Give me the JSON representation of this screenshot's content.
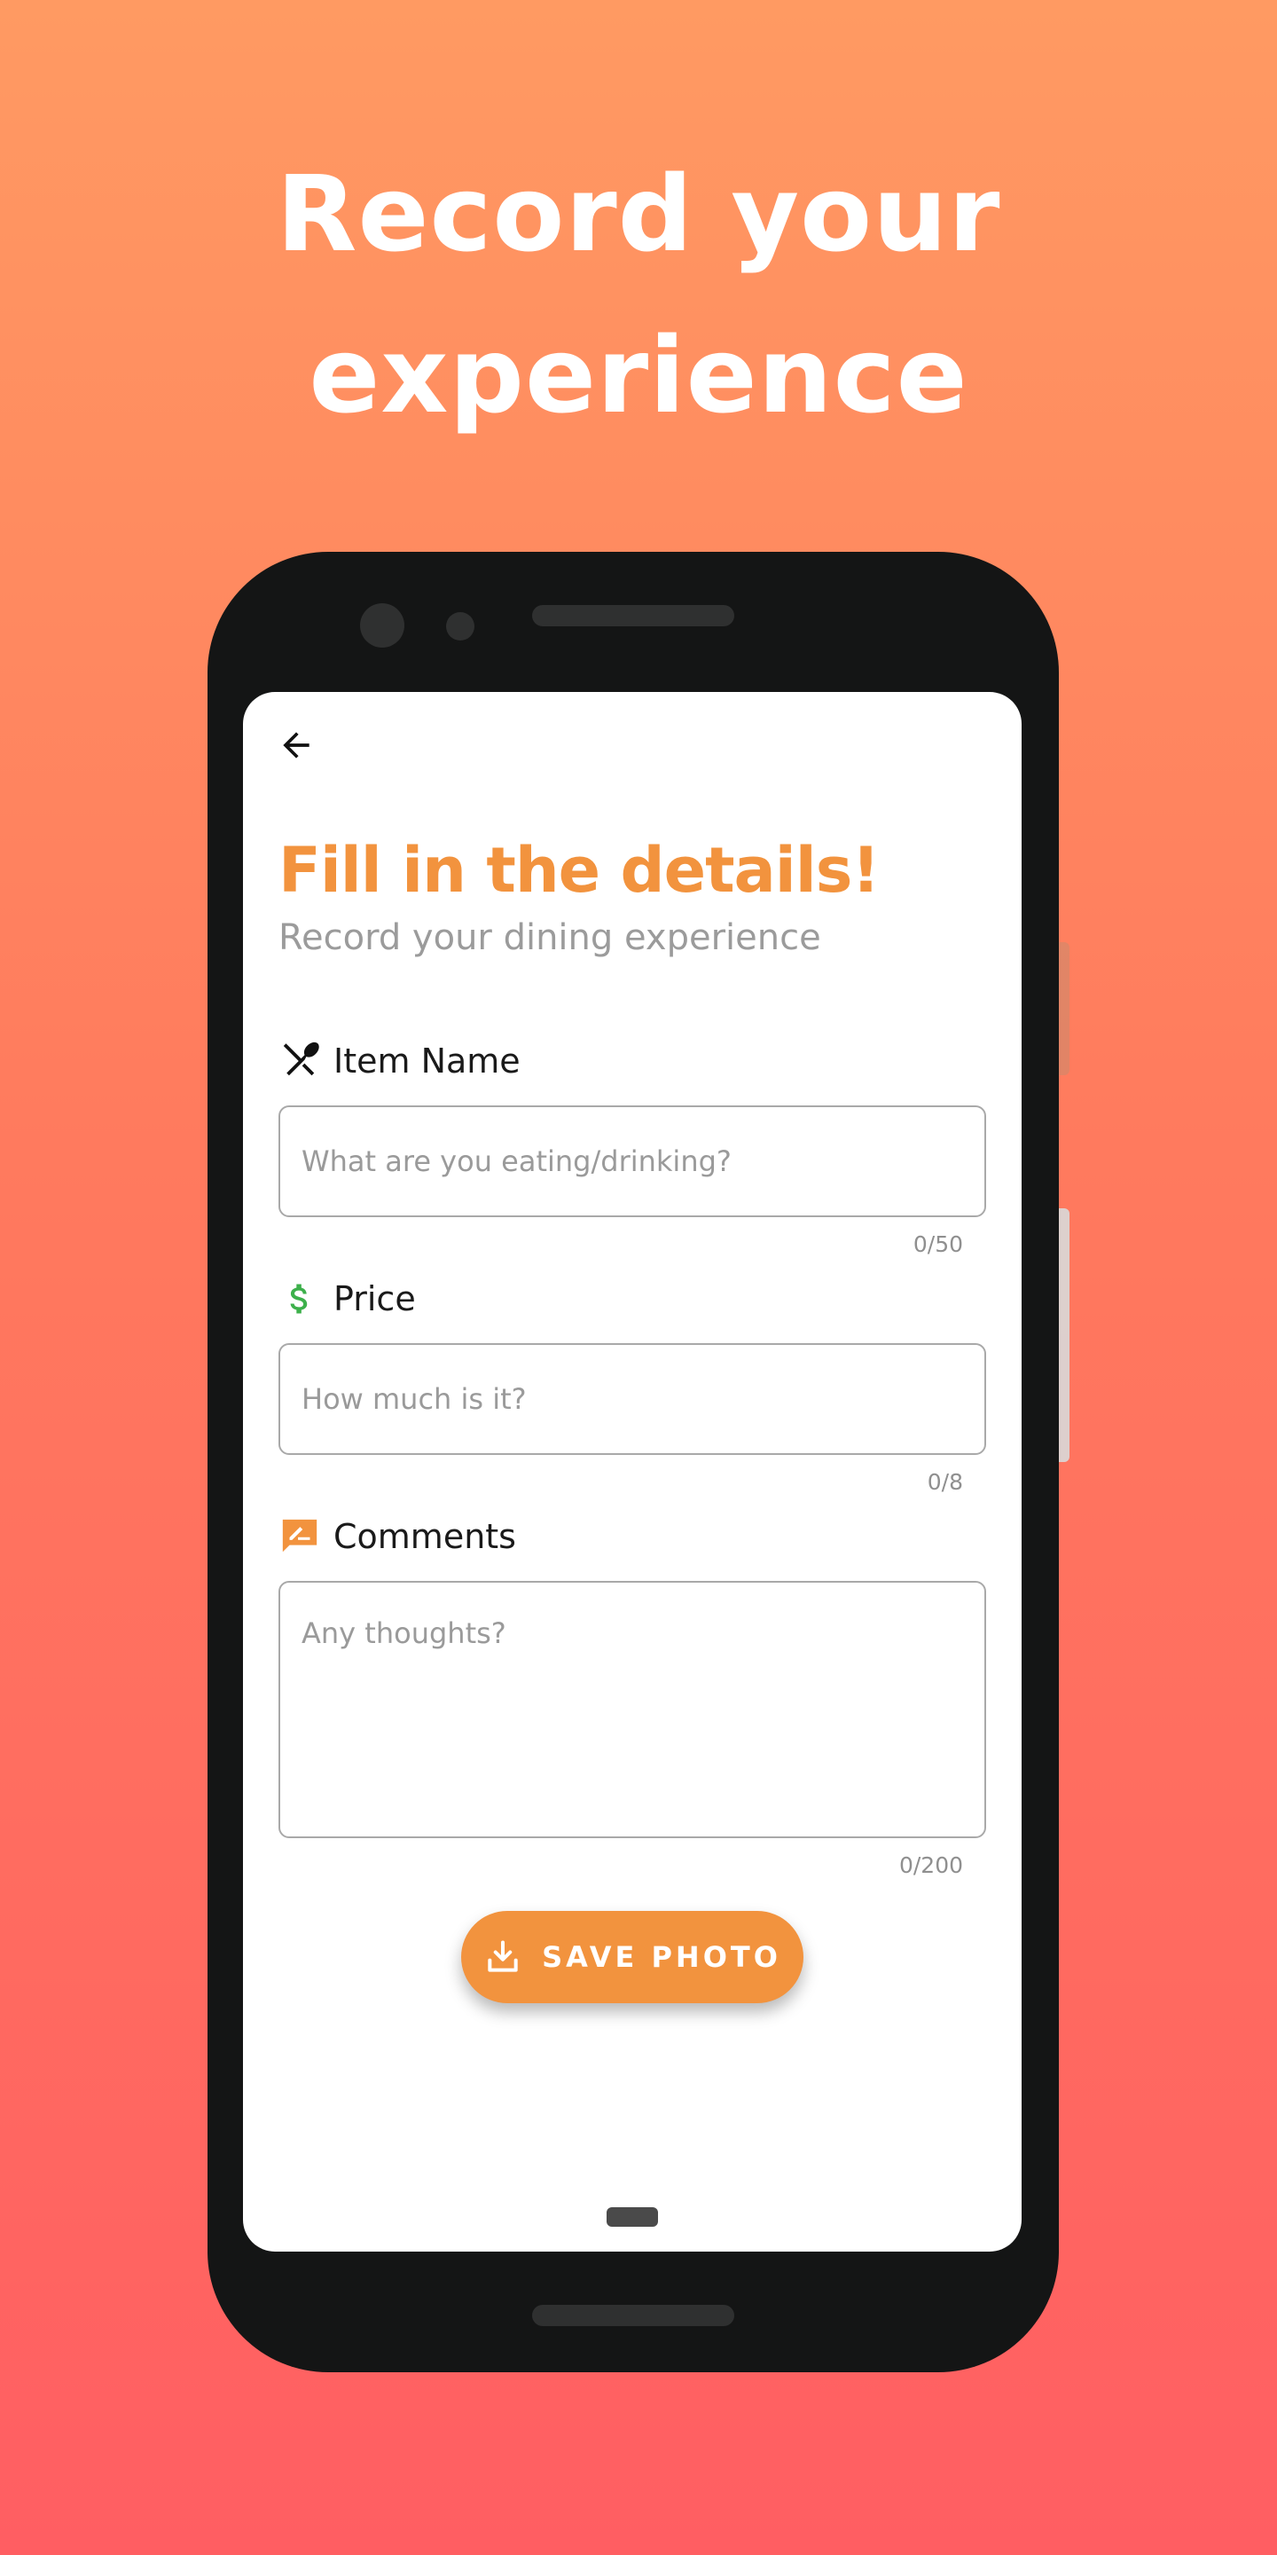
{
  "headline": {
    "line1": "Record your",
    "line2": "experience"
  },
  "screen": {
    "title": "Fill in the details!",
    "subtitle": "Record your dining experience",
    "fields": {
      "item_name": {
        "label": "Item Name",
        "placeholder": "What are you eating/drinking?",
        "value": "",
        "counter": "0/50",
        "icon": "fork-spoon-icon"
      },
      "price": {
        "label": "Price",
        "placeholder": "How much is it?",
        "value": "",
        "counter": "0/8",
        "icon": "dollar-icon"
      },
      "comments": {
        "label": "Comments",
        "placeholder": "Any thoughts?",
        "value": "",
        "counter": "0/200",
        "icon": "comment-edit-icon"
      }
    },
    "save_button": {
      "label": "SAVE PHOTO",
      "icon": "download-icon"
    }
  },
  "colors": {
    "accent": "#F2933E",
    "price_icon": "#3DB04B",
    "background_top": "#FF9A62",
    "background_bottom": "#FF5E62"
  }
}
